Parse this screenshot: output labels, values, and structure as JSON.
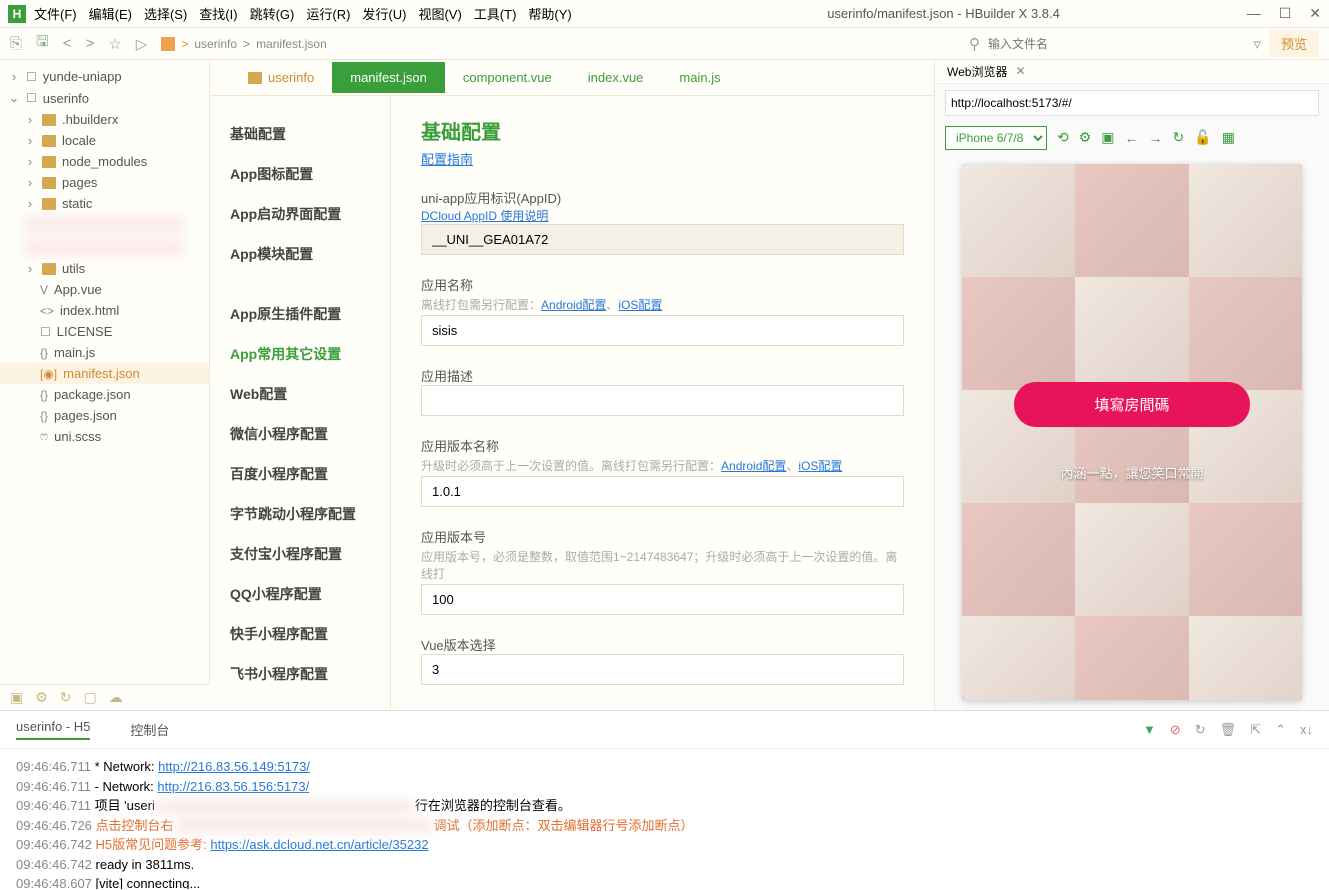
{
  "window": {
    "title": "userinfo/manifest.json - HBuilder X 3.8.4"
  },
  "menubar": [
    "文件(F)",
    "编辑(E)",
    "选择(S)",
    "查找(I)",
    "跳转(G)",
    "运行(R)",
    "发行(U)",
    "视图(V)",
    "工具(T)",
    "帮助(Y)"
  ],
  "breadcrumb": [
    "userinfo",
    "manifest.json"
  ],
  "toolbar": {
    "search_ph": "输入文件名",
    "preview_btn": "预览"
  },
  "tree": [
    {
      "indent": 0,
      "name": "yunde-uniapp",
      "type": "root",
      "caret": ">"
    },
    {
      "indent": 0,
      "name": "userinfo",
      "type": "root",
      "caret": "v"
    },
    {
      "indent": 1,
      "name": ".hbuilderx",
      "type": "folder",
      "caret": ">"
    },
    {
      "indent": 1,
      "name": "locale",
      "type": "folder",
      "caret": ">"
    },
    {
      "indent": 1,
      "name": "node_modules",
      "type": "folder",
      "caret": ">"
    },
    {
      "indent": 1,
      "name": "pages",
      "type": "folder",
      "caret": ">"
    },
    {
      "indent": 1,
      "name": "static",
      "type": "folder",
      "caret": ">"
    },
    {
      "indent": 1,
      "name": "",
      "type": "redact",
      "caret": ""
    },
    {
      "indent": 1,
      "name": "",
      "type": "redact",
      "caret": ""
    },
    {
      "indent": 1,
      "name": "utils",
      "type": "folder",
      "caret": ">"
    },
    {
      "indent": 2,
      "name": "App.vue",
      "type": "file",
      "ico": "V"
    },
    {
      "indent": 2,
      "name": "index.html",
      "type": "file",
      "ico": "<>"
    },
    {
      "indent": 2,
      "name": "LICENSE",
      "type": "file",
      "ico": "☐"
    },
    {
      "indent": 2,
      "name": "main.js",
      "type": "file",
      "ico": "{}"
    },
    {
      "indent": 2,
      "name": "manifest.json",
      "type": "file",
      "ico": "[◉]",
      "sel": true
    },
    {
      "indent": 2,
      "name": "package.json",
      "type": "file",
      "ico": "{}"
    },
    {
      "indent": 2,
      "name": "pages.json",
      "type": "file",
      "ico": "{}"
    },
    {
      "indent": 2,
      "name": "uni.scss",
      "type": "file",
      "ico": "ෆ"
    }
  ],
  "tabs": [
    {
      "label": "userinfo",
      "type": "folder"
    },
    {
      "label": "manifest.json",
      "type": "active"
    },
    {
      "label": "component.vue",
      "type": "inactive"
    },
    {
      "label": "index.vue",
      "type": "inactive"
    },
    {
      "label": "main.js",
      "type": "inactive"
    }
  ],
  "sidenav": [
    "基础配置",
    "App图标配置",
    "App启动界面配置",
    "App模块配置",
    "",
    "App原生插件配置",
    "App常用其它设置",
    "Web配置",
    "微信小程序配置",
    "百度小程序配置",
    "字节跳动小程序配置",
    "支付宝小程序配置",
    "QQ小程序配置",
    "快手小程序配置",
    "飞书小程序配置"
  ],
  "sidenav_active": 6,
  "form": {
    "heading": "基础配置",
    "guide": "配置指南",
    "appid_lbl": "uni-app应用标识(AppID)",
    "appid_link": "DCloud AppID 使用说明",
    "appid_val": "__UNI__GEA01A72",
    "name_lbl": "应用名称",
    "name_hint": "离线打包需另行配置：",
    "android_link": "Android配置",
    "ios_link": "iOS配置",
    "name_val": "sisis",
    "desc_lbl": "应用描述",
    "desc_val": "",
    "vername_lbl": "应用版本名称",
    "vername_hint": "升级时必须高于上一次设置的值。离线打包需另行配置：",
    "vername_val": "1.0.1",
    "vercode_lbl": "应用版本号",
    "vercode_hint": "应用版本号，必须是整数，取值范围1~2147483647；升级时必须高于上一次设置的值。离线打",
    "vercode_val": "100",
    "vue_lbl": "Vue版本选择",
    "vue_val": "3"
  },
  "preview": {
    "tab": "Web浏览器",
    "url": "http://localhost:5173/#/",
    "device": "iPhone 6/7/8",
    "btn": "填寫房間碼",
    "slogan": "內涵一點，讓您笑口常開"
  },
  "console": {
    "tab1": "userinfo - H5",
    "tab2": "控制台",
    "lines": [
      {
        "ts": "09:46:46.711",
        "text": "  * Network:  ",
        "link": "http://216.83.56.149:5173/"
      },
      {
        "ts": "09:46:46.711",
        "text": "  - Network:  ",
        "link": "http://216.83.56.156:5173/"
      },
      {
        "ts": "09:46:46.711",
        "text": "项目 'useri",
        "redact": true,
        "tail": "行在浏览器的控制台查看。"
      },
      {
        "ts": "09:46:46.726",
        "orange": "点击控制台右",
        "redact": true,
        "tail": "调试（添加断点：双击编辑器行号添加断点）"
      },
      {
        "ts": "09:46:46.742",
        "orange": "H5版常见问题参考: ",
        "link": "https://ask.dcloud.net.cn/article/35232"
      },
      {
        "ts": "09:46:46.742",
        "text": "  ready in 3811ms."
      },
      {
        "ts": "09:46:48.607",
        "text": "[vite] connecting..."
      }
    ]
  }
}
